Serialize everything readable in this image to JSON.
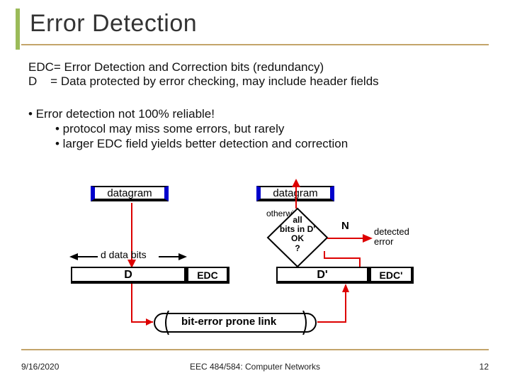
{
  "title": "Error Detection",
  "defs": {
    "line1": "EDC= Error Detection and Correction bits (redundancy)",
    "line2": "D    = Data protected by error checking, may include header fields"
  },
  "bullets": {
    "l1": "• Error detection not 100% reliable!",
    "l2": "• protocol may miss some errors, but rarely",
    "l3": "• larger EDC field yields better detection and correction"
  },
  "diagram": {
    "datagram_left": "datagram",
    "datagram_right": "datagram",
    "otherwise": "otherwise",
    "d_bits": "d data bits",
    "D": "D",
    "EDC": "EDC",
    "Dp": "D'",
    "EDCp": "EDC'",
    "check": "all\nbits in D'\nOK\n?",
    "N": "N",
    "detected": "detected\nerror",
    "link": "bit-error prone link"
  },
  "footer": {
    "date": "9/16/2020",
    "course": "EEC 484/584: Computer Networks",
    "page": "12"
  }
}
